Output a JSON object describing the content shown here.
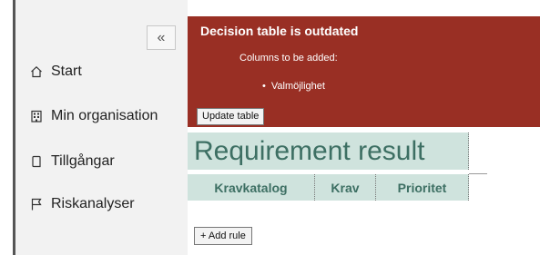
{
  "sidebar": {
    "collapse_symbol": "«",
    "items": [
      {
        "label": "Start",
        "icon": "home-icon"
      },
      {
        "label": "Min organisation",
        "icon": "building-icon"
      },
      {
        "label": "Tillgångar",
        "icon": "document-icon"
      },
      {
        "label": "Riskanalyser",
        "icon": "flag-icon"
      }
    ]
  },
  "banner": {
    "title": "Decision table is outdated",
    "subtitle": "Columns to be added:",
    "bullet_symbol": "•",
    "items": [
      "Valmöjlighet"
    ],
    "update_button": "Update table",
    "background_color": "#992f24"
  },
  "table": {
    "title": "Requirement result",
    "columns": [
      "Kravkatalog",
      "Krav",
      "Prioritet"
    ],
    "header_bg": "#cfe3dd",
    "header_text_color": "#3d6f63",
    "add_rule_button": "+ Add rule"
  }
}
